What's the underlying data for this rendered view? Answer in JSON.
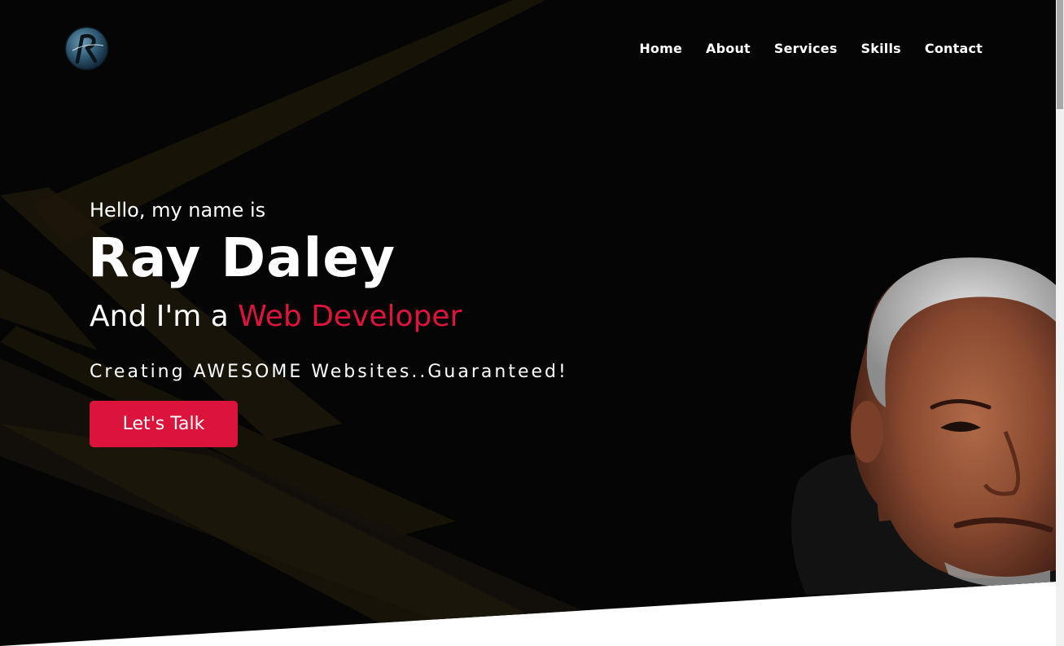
{
  "nav": {
    "items": [
      {
        "label": "Home",
        "name": "nav-home"
      },
      {
        "label": "About",
        "name": "nav-about"
      },
      {
        "label": "Services",
        "name": "nav-services"
      },
      {
        "label": "Skills",
        "name": "nav-skills"
      },
      {
        "label": "Contact",
        "name": "nav-contact"
      }
    ]
  },
  "hero": {
    "greeting": "Hello, my name is",
    "name": "Ray Daley",
    "role_prefix": "And I'm a ",
    "role_highlight": "Web Developer",
    "tagline": "Creating AWESOME Websites..Guaranteed!",
    "cta_label": "Let's Talk"
  },
  "colors": {
    "accent": "#dc143c",
    "background": "#050505",
    "text": "#ffffff"
  },
  "icons": {
    "logo": "r-monogram-logo"
  }
}
